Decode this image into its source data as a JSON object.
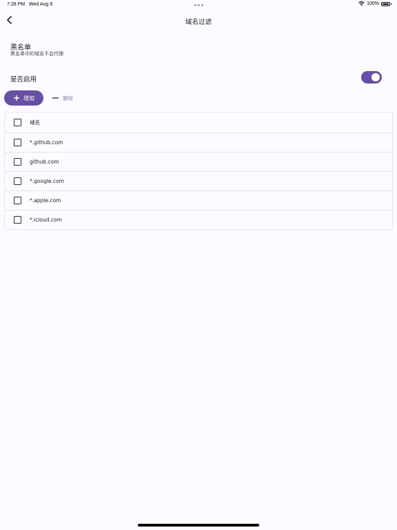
{
  "status_bar": {
    "time": "7:28 PM",
    "date": "Wed Aug 9",
    "battery": "100%"
  },
  "app_bar": {
    "title": "域名过滤"
  },
  "section": {
    "title": "黑名单",
    "subtitle": "黑名单中的域名不会代理"
  },
  "enable": {
    "label": "是否启用",
    "toggle_on": true
  },
  "actions": {
    "add_label": "增加",
    "delete_label": "删除"
  },
  "table": {
    "header": "域名",
    "rows": [
      "*.github.com",
      "github.com",
      "*.google.com",
      "*.apple.com",
      "*.icloud.com"
    ]
  },
  "colors": {
    "accent": "#6750a4",
    "background": "#fdfbff"
  }
}
